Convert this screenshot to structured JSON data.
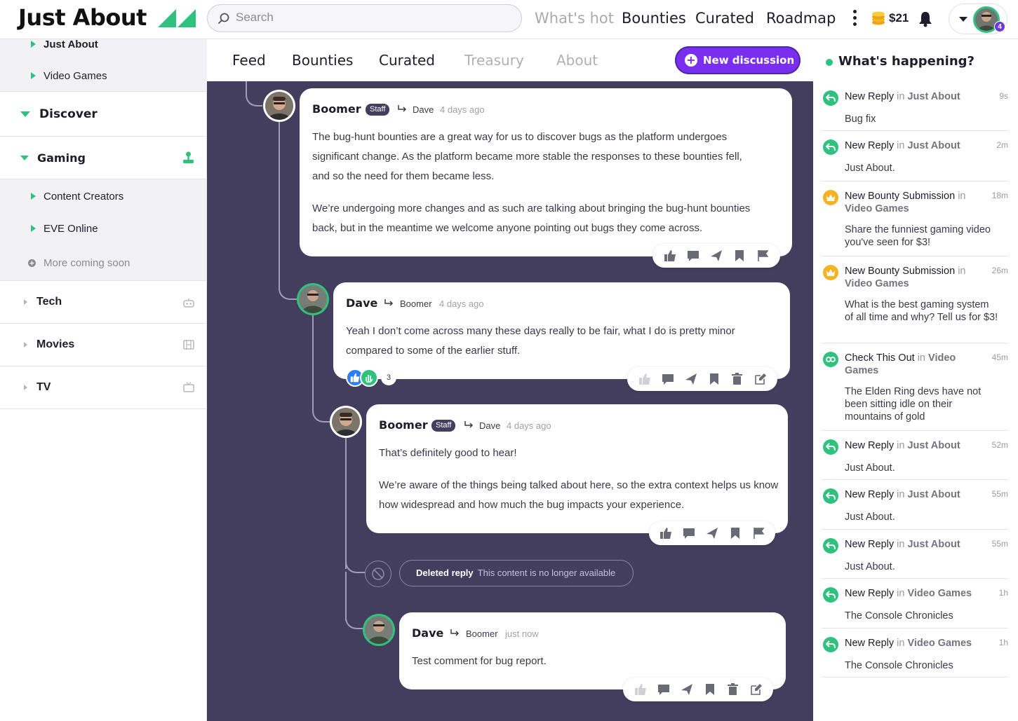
{
  "app": {
    "logo_text": "Just About",
    "search_placeholder": "Search",
    "nav": [
      "What's hot",
      "Bounties",
      "Curated",
      "Roadmap"
    ],
    "balance": "$21",
    "notification_count": "4"
  },
  "sidebar": {
    "sub_top": [
      "Just About",
      "Video Games"
    ],
    "discover": "Discover",
    "gaming": "Gaming",
    "gaming_items": [
      "Content Creators",
      "EVE Online"
    ],
    "coming_soon": "More coming soon",
    "categories": [
      "Tech",
      "Movies",
      "TV"
    ]
  },
  "feed": {
    "tabs": [
      "Feed",
      "Bounties",
      "Curated",
      "Treasury",
      "About"
    ],
    "new_discussion": "New discussion",
    "staff_label": "Staff",
    "posts": [
      {
        "author": "Boomer",
        "reply_to": "Dave",
        "ago": "4 days ago",
        "p1": "The bug-hunt bounties are a great way for us to discover bugs as the platform undergoes significant change. As the platform became more stable the responses to these bounties fell, and so the need for them became less.",
        "p2": "We’re undergoing more changes and as such are talking about bringing the bug-hunt bounties back, but in the meantime we welcome anyone pointing out bugs they come across."
      },
      {
        "author": "Dave",
        "reply_to": "Boomer",
        "ago": "4 days ago",
        "p1": "Yeah I don’t come across many these days really to be fair, what I do is pretty minor compared to some of the earlier stuff.",
        "reaction_count": "3"
      },
      {
        "author": "Boomer",
        "reply_to": "Dave",
        "ago": "4 days ago",
        "p1": "That’s definitely good to hear!",
        "p2": "We’re aware of the things being talked about here, so the extra context helps us know how widespread and how much the bug impacts your experience."
      },
      {
        "author": "Dave",
        "reply_to": "Boomer",
        "ago": "just now",
        "p1": "Test comment for bug report."
      }
    ],
    "deleted_title": "Deleted reply",
    "deleted_sub": "This content is no longer available"
  },
  "activity": {
    "title": "What's happening?",
    "in_word": "in",
    "items": [
      {
        "type": "New Reply",
        "where": "Just About",
        "time": "9s",
        "text": "Bug fix",
        "icon": "reply-icon",
        "color": "#2ec27e"
      },
      {
        "type": "New Reply",
        "where": "Just About",
        "time": "2m",
        "text": "Just About.",
        "icon": "reply-icon",
        "color": "#2ec27e"
      },
      {
        "type": "New Bounty Submission",
        "where": "Video Games",
        "time": "18m",
        "text": "Share the funniest gaming video you've seen for $3!",
        "icon": "crown-icon",
        "color": "#f5b324"
      },
      {
        "type": "New Bounty Submission",
        "where": "Video Games",
        "time": "26m",
        "text": "What is the best gaming system of all time and why? Tell us for $3!",
        "icon": "crown-icon",
        "color": "#f5b324"
      },
      {
        "type": "Check This Out",
        "where": "Video Games",
        "time": "45m",
        "text": "The Elden Ring devs have not been sitting idle on their mountains of gold",
        "icon": "eyes-icon",
        "color": "#2ec27e"
      },
      {
        "type": "New Reply",
        "where": "Just About",
        "time": "52m",
        "text": "Just About.",
        "icon": "reply-icon",
        "color": "#2ec27e"
      },
      {
        "type": "New Reply",
        "where": "Just About",
        "time": "55m",
        "text": "Just About.",
        "icon": "reply-icon",
        "color": "#2ec27e"
      },
      {
        "type": "New Reply",
        "where": "Just About",
        "time": "55m",
        "text": "Just About.",
        "icon": "reply-icon",
        "color": "#2ec27e"
      },
      {
        "type": "New Reply",
        "where": "Video Games",
        "time": "1h",
        "text": "The Console Chronicles",
        "icon": "reply-icon",
        "color": "#2ec27e"
      },
      {
        "type": "New Reply",
        "where": "Video Games",
        "time": "1h",
        "text": "The Console Chronicles",
        "icon": "reply-icon",
        "color": "#2ec27e"
      }
    ]
  },
  "colors": {
    "accent": "#2ec27e",
    "primary": "#7a2ff0",
    "feed_bg": "#433e5e"
  }
}
